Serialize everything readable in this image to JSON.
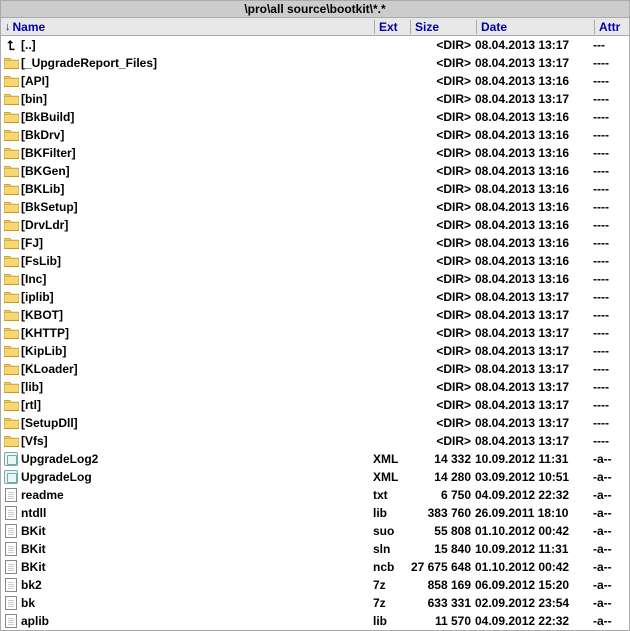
{
  "path": "\\pro\\all source\\bootkit\\*.*",
  "columns": {
    "name": "Name",
    "ext": "Ext",
    "size": "Size",
    "date": "Date",
    "attr": "Attr"
  },
  "sort_indicator": "↓",
  "rows": [
    {
      "type": "up",
      "name": "[..]",
      "ext": "",
      "size": "<DIR>",
      "date": "08.04.2013 13:17",
      "attr": "---"
    },
    {
      "type": "folder",
      "name": "[_UpgradeReport_Files]",
      "ext": "",
      "size": "<DIR>",
      "date": "08.04.2013 13:17",
      "attr": "----"
    },
    {
      "type": "folder",
      "name": "[API]",
      "ext": "",
      "size": "<DIR>",
      "date": "08.04.2013 13:16",
      "attr": "----"
    },
    {
      "type": "folder",
      "name": "[bin]",
      "ext": "",
      "size": "<DIR>",
      "date": "08.04.2013 13:17",
      "attr": "----"
    },
    {
      "type": "folder",
      "name": "[BkBuild]",
      "ext": "",
      "size": "<DIR>",
      "date": "08.04.2013 13:16",
      "attr": "----"
    },
    {
      "type": "folder",
      "name": "[BkDrv]",
      "ext": "",
      "size": "<DIR>",
      "date": "08.04.2013 13:16",
      "attr": "----"
    },
    {
      "type": "folder",
      "name": "[BKFilter]",
      "ext": "",
      "size": "<DIR>",
      "date": "08.04.2013 13:16",
      "attr": "----"
    },
    {
      "type": "folder",
      "name": "[BKGen]",
      "ext": "",
      "size": "<DIR>",
      "date": "08.04.2013 13:16",
      "attr": "----"
    },
    {
      "type": "folder",
      "name": "[BKLib]",
      "ext": "",
      "size": "<DIR>",
      "date": "08.04.2013 13:16",
      "attr": "----"
    },
    {
      "type": "folder",
      "name": "[BkSetup]",
      "ext": "",
      "size": "<DIR>",
      "date": "08.04.2013 13:16",
      "attr": "----"
    },
    {
      "type": "folder",
      "name": "[DrvLdr]",
      "ext": "",
      "size": "<DIR>",
      "date": "08.04.2013 13:16",
      "attr": "----"
    },
    {
      "type": "folder",
      "name": "[FJ]",
      "ext": "",
      "size": "<DIR>",
      "date": "08.04.2013 13:16",
      "attr": "----"
    },
    {
      "type": "folder",
      "name": "[FsLib]",
      "ext": "",
      "size": "<DIR>",
      "date": "08.04.2013 13:16",
      "attr": "----"
    },
    {
      "type": "folder",
      "name": "[Inc]",
      "ext": "",
      "size": "<DIR>",
      "date": "08.04.2013 13:16",
      "attr": "----"
    },
    {
      "type": "folder",
      "name": "[iplib]",
      "ext": "",
      "size": "<DIR>",
      "date": "08.04.2013 13:17",
      "attr": "----"
    },
    {
      "type": "folder",
      "name": "[KBOT]",
      "ext": "",
      "size": "<DIR>",
      "date": "08.04.2013 13:17",
      "attr": "----"
    },
    {
      "type": "folder",
      "name": "[KHTTP]",
      "ext": "",
      "size": "<DIR>",
      "date": "08.04.2013 13:17",
      "attr": "----"
    },
    {
      "type": "folder",
      "name": "[KipLib]",
      "ext": "",
      "size": "<DIR>",
      "date": "08.04.2013 13:17",
      "attr": "----"
    },
    {
      "type": "folder",
      "name": "[KLoader]",
      "ext": "",
      "size": "<DIR>",
      "date": "08.04.2013 13:17",
      "attr": "----"
    },
    {
      "type": "folder",
      "name": "[lib]",
      "ext": "",
      "size": "<DIR>",
      "date": "08.04.2013 13:17",
      "attr": "----"
    },
    {
      "type": "folder",
      "name": "[rtl]",
      "ext": "",
      "size": "<DIR>",
      "date": "08.04.2013 13:17",
      "attr": "----"
    },
    {
      "type": "folder",
      "name": "[SetupDll]",
      "ext": "",
      "size": "<DIR>",
      "date": "08.04.2013 13:17",
      "attr": "----"
    },
    {
      "type": "folder",
      "name": "[Vfs]",
      "ext": "",
      "size": "<DIR>",
      "date": "08.04.2013 13:17",
      "attr": "----"
    },
    {
      "type": "xml",
      "name": "UpgradeLog2",
      "ext": "XML",
      "size": "14 332",
      "date": "10.09.2012 11:31",
      "attr": "-a--"
    },
    {
      "type": "xml",
      "name": "UpgradeLog",
      "ext": "XML",
      "size": "14 280",
      "date": "03.09.2012 10:51",
      "attr": "-a--"
    },
    {
      "type": "file",
      "name": "readme",
      "ext": "txt",
      "size": "6 750",
      "date": "04.09.2012 22:32",
      "attr": "-a--"
    },
    {
      "type": "file",
      "name": "ntdll",
      "ext": "lib",
      "size": "383 760",
      "date": "26.09.2011 18:10",
      "attr": "-a--"
    },
    {
      "type": "file",
      "name": "BKit",
      "ext": "suo",
      "size": "55 808",
      "date": "01.10.2012 00:42",
      "attr": "-a--"
    },
    {
      "type": "file",
      "name": "BKit",
      "ext": "sln",
      "size": "15 840",
      "date": "10.09.2012 11:31",
      "attr": "-a--"
    },
    {
      "type": "file",
      "name": "BKit",
      "ext": "ncb",
      "size": "27 675 648",
      "date": "01.10.2012 00:42",
      "attr": "-a--"
    },
    {
      "type": "file",
      "name": "bk2",
      "ext": "7z",
      "size": "858 169",
      "date": "06.09.2012 15:20",
      "attr": "-a--"
    },
    {
      "type": "file",
      "name": "bk",
      "ext": "7z",
      "size": "633 331",
      "date": "02.09.2012 23:54",
      "attr": "-a--"
    },
    {
      "type": "file",
      "name": "aplib",
      "ext": "lib",
      "size": "11 570",
      "date": "04.09.2012 22:32",
      "attr": "-a--"
    }
  ]
}
